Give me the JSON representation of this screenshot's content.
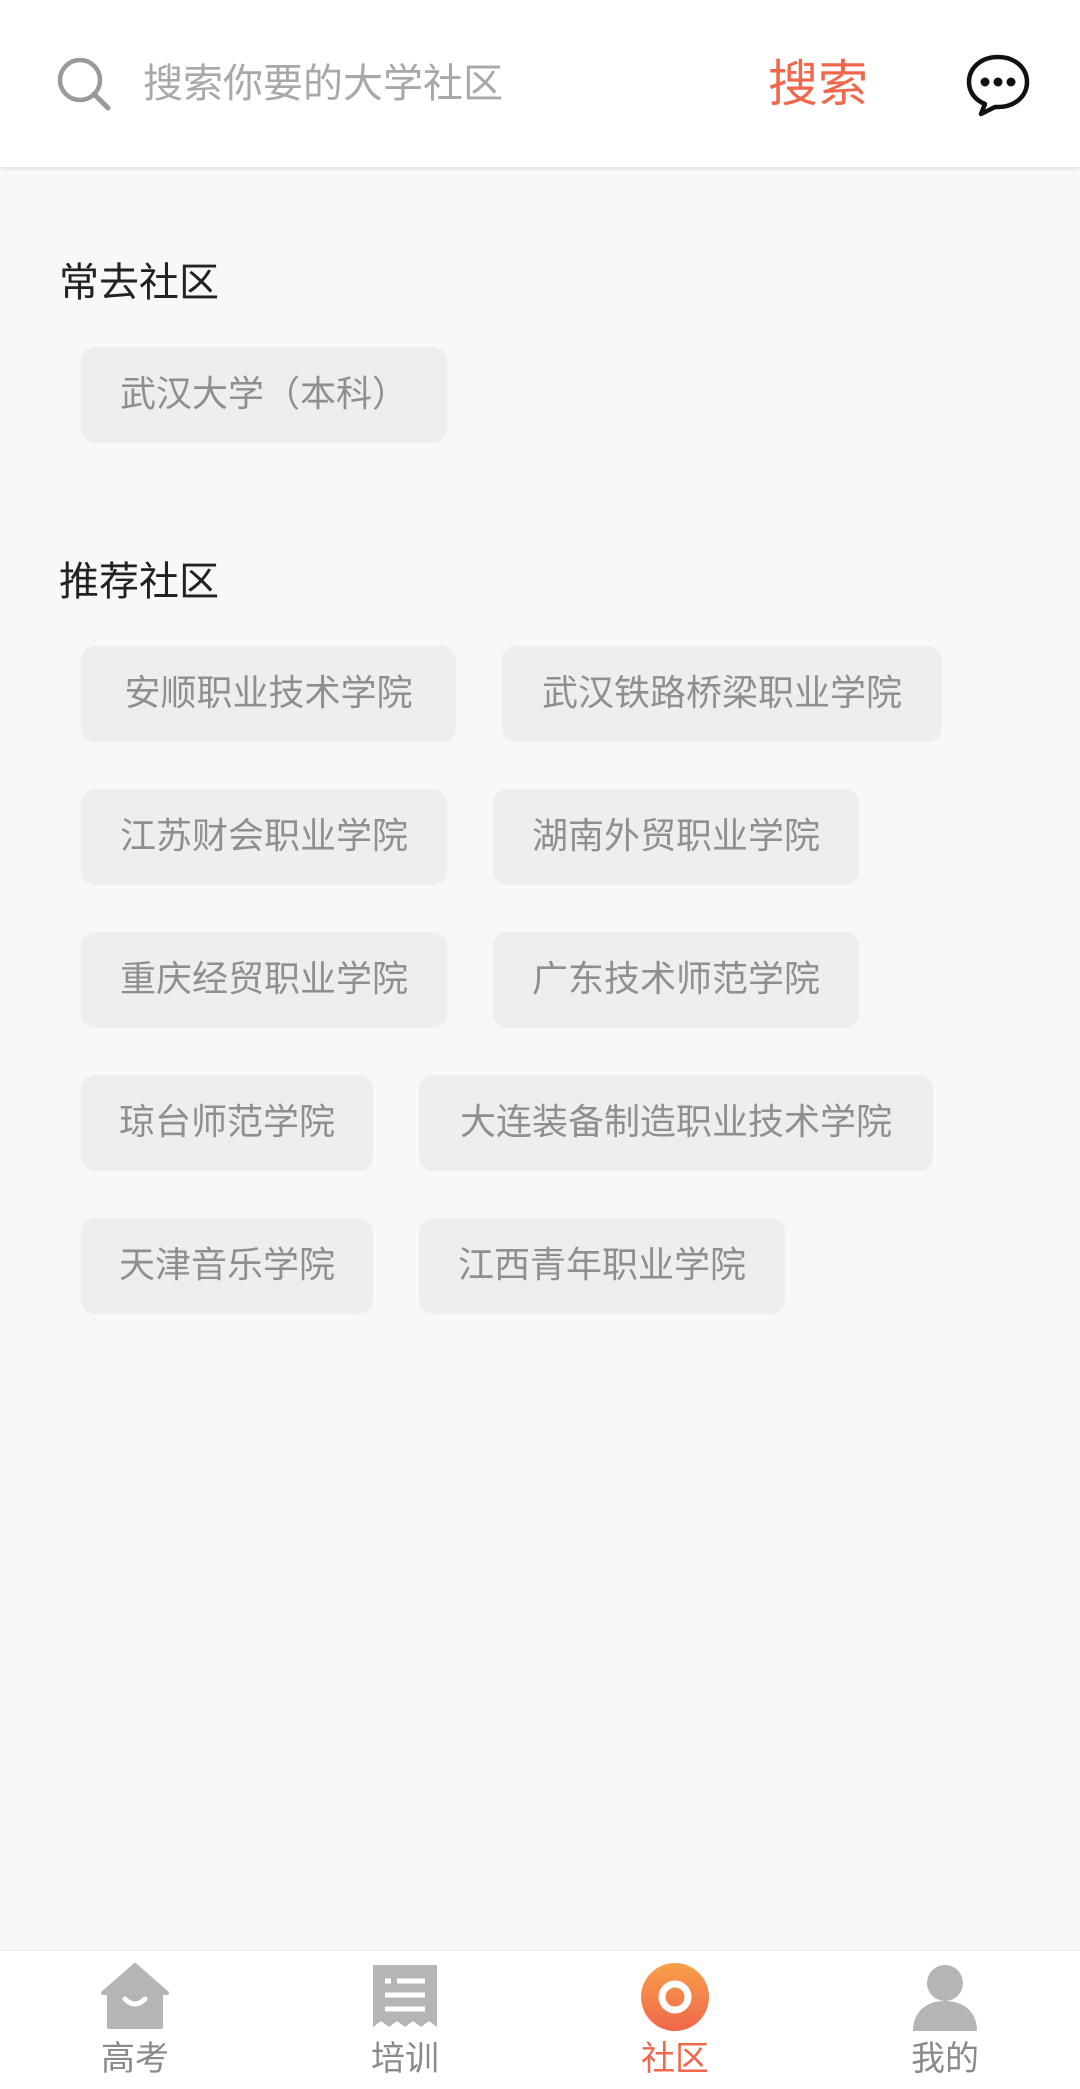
{
  "search": {
    "placeholder": "搜索你要的大学社区",
    "button_label": "搜索",
    "message_icon": "chat-bubble-icon"
  },
  "frequent": {
    "title": "常去社区",
    "items": [
      "武汉大学（本科）"
    ]
  },
  "recommended": {
    "title": "推荐社区",
    "items": [
      "安顺职业技术学院",
      "武汉铁路桥梁职业学院",
      "江苏财会职业学院",
      "湖南外贸职业学院",
      "重庆经贸职业学院",
      "广东技术师范学院",
      "琼台师范学院",
      "大连装备制造职业技术学院",
      "天津音乐学院",
      "江西青年职业学院"
    ]
  },
  "tabs": [
    {
      "label": "高考",
      "icon": "home-icon",
      "active": false
    },
    {
      "label": "培训",
      "icon": "document-icon",
      "active": false
    },
    {
      "label": "社区",
      "icon": "community-ring-icon",
      "active": true
    },
    {
      "label": "我的",
      "icon": "user-icon",
      "active": false
    }
  ],
  "colors": {
    "accent": "#f0674b",
    "chip_bg": "#eeeeee",
    "chip_text": "#8f8f8f",
    "page_bg": "#f8f8f8"
  }
}
